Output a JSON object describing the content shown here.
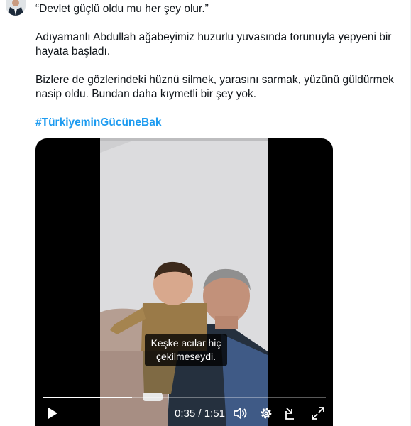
{
  "tweet": {
    "line1": "“Devlet güçlü oldu mu her şey olur.”",
    "line2": "Adıyamanlı Abdullah ağabeyimiz huzurlu yuvasında torunuyla yepyeni bir hayata başladı.",
    "line3": "Bizlere de gözlerindeki hüznü silmek, yarasını sarmak, yüzünü güldürmek nasip oldu. Bundan daha kıymetli bir şey yok.",
    "hashtag": "#TürkiyeminGücüneBak"
  },
  "video": {
    "subtitle_line1": "Keşke acılar hiç",
    "subtitle_line2": "çekilmeseydi.",
    "current_time": "0:35",
    "separator": " / ",
    "duration": "1:51",
    "progress_fraction": 0.315
  },
  "icons": {
    "play": "play-icon",
    "volume": "volume-icon",
    "settings": "gear-icon",
    "popout": "popout-icon",
    "fullscreen": "fullscreen-icon"
  },
  "colors": {
    "hashtag": "#1d9bf0",
    "video_bg": "#000000"
  }
}
